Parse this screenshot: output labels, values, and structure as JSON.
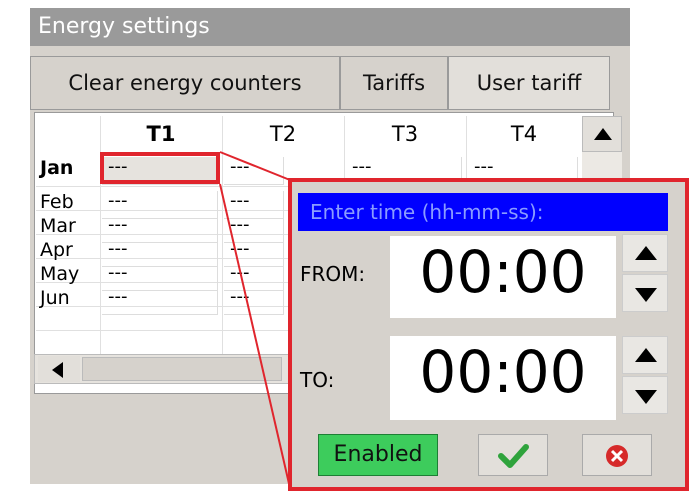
{
  "window": {
    "title": "Energy settings"
  },
  "tabs": [
    {
      "label": "Clear energy counters"
    },
    {
      "label": "Tariffs"
    },
    {
      "label": "User tariff"
    }
  ],
  "table": {
    "columns": [
      "T1",
      "T2",
      "T3",
      "T4"
    ],
    "rows": [
      {
        "label": "Jan",
        "cells": [
          "---",
          "---",
          "---",
          "---"
        ]
      },
      {
        "label": "Feb",
        "cells": [
          "---",
          "---"
        ]
      },
      {
        "label": "Mar",
        "cells": [
          "---",
          "---"
        ]
      },
      {
        "label": "Apr",
        "cells": [
          "---",
          "---"
        ]
      },
      {
        "label": "May",
        "cells": [
          "---",
          "---"
        ]
      },
      {
        "label": "Jun",
        "cells": [
          "---",
          "---"
        ]
      }
    ]
  },
  "dialog": {
    "title": "Enter time (hh-mm-ss):",
    "from_label": "FROM:",
    "from_value": "00:00",
    "to_label": "TO:",
    "to_value": "00:00",
    "enabled_label": "Enabled",
    "ok_icon": "checkmark-icon",
    "cancel_icon": "cancel-icon"
  },
  "colors": {
    "callout": "#e0252d",
    "dialog_title_bg": "#0000ff",
    "enabled_bg": "#3dcc5c"
  }
}
